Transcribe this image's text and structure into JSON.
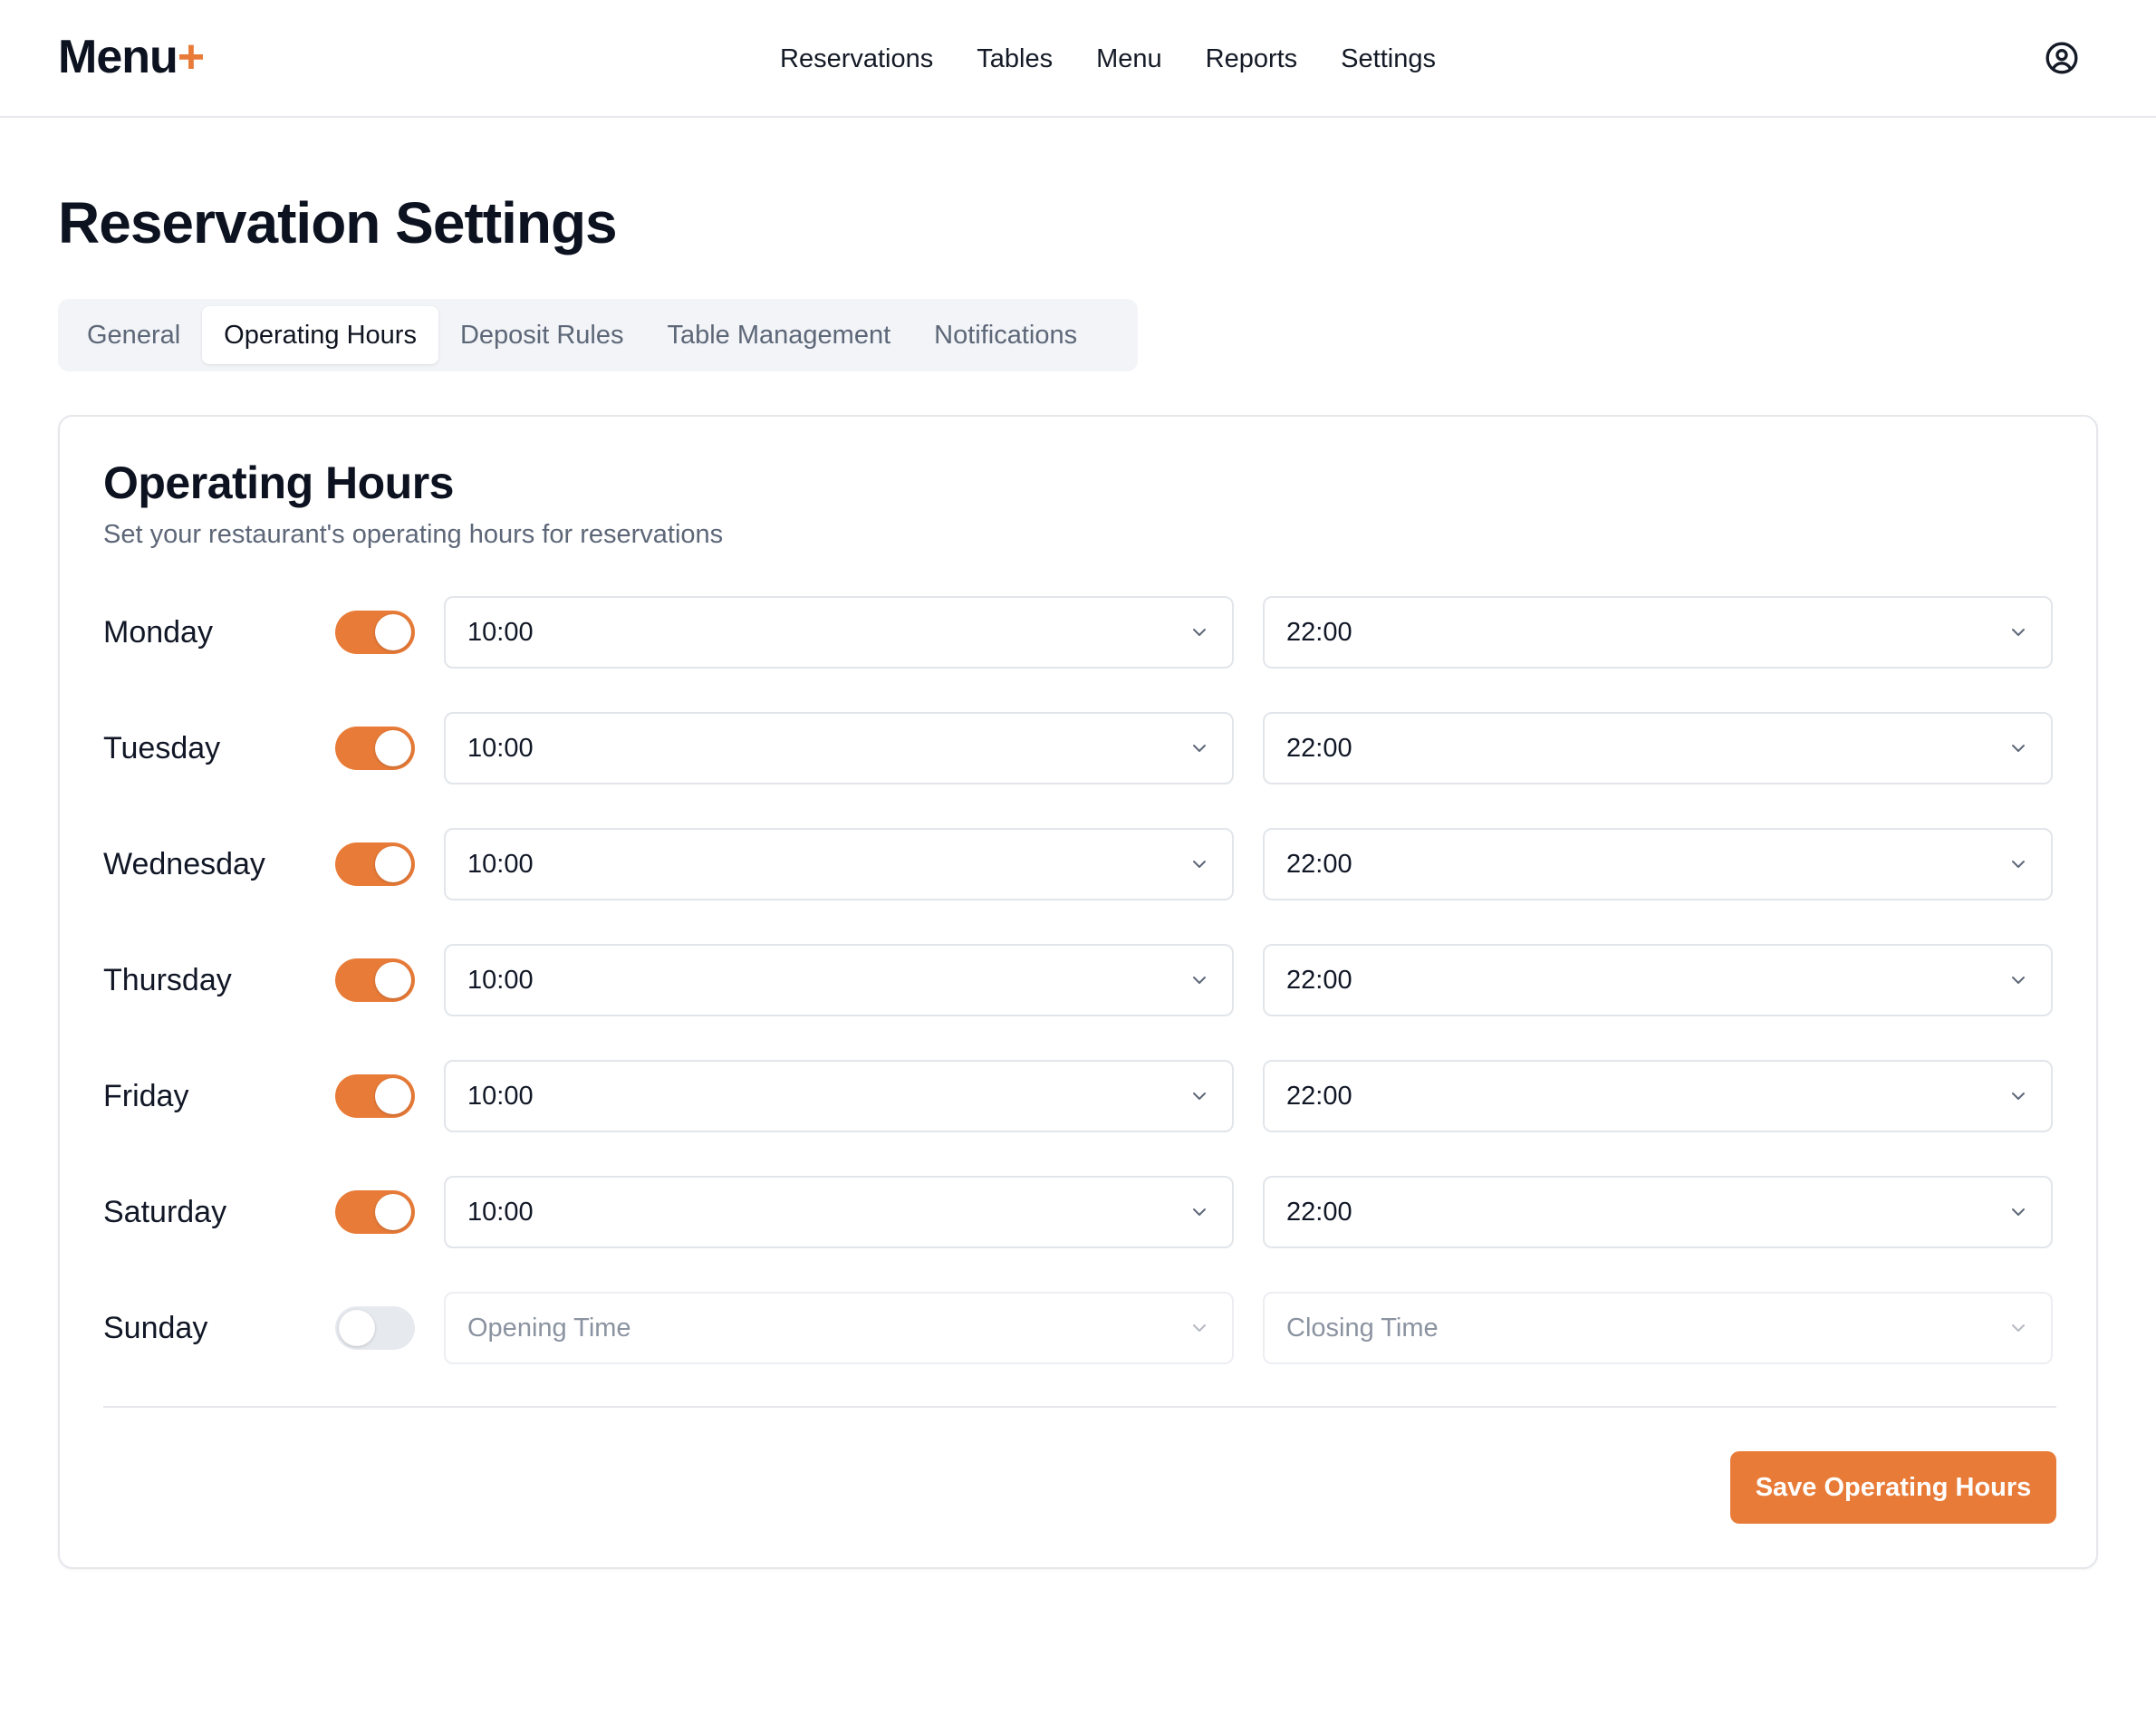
{
  "app": {
    "logo_text": "Menu",
    "logo_accent": "+",
    "accent_color": "#e87b38"
  },
  "nav": {
    "items": [
      "Reservations",
      "Tables",
      "Menu",
      "Reports",
      "Settings"
    ],
    "user_icon": "user-circle-icon"
  },
  "page": {
    "title": "Reservation Settings"
  },
  "tabs": {
    "items": [
      "General",
      "Operating Hours",
      "Deposit Rules",
      "Table Management",
      "Notifications"
    ],
    "active": "Operating Hours"
  },
  "card": {
    "title": "Operating Hours",
    "subtitle": "Set your restaurant's operating hours for reservations",
    "days": [
      {
        "day": "Monday",
        "enabled": true,
        "open": "10:00",
        "close": "22:00"
      },
      {
        "day": "Tuesday",
        "enabled": true,
        "open": "10:00",
        "close": "22:00"
      },
      {
        "day": "Wednesday",
        "enabled": true,
        "open": "10:00",
        "close": "22:00"
      },
      {
        "day": "Thursday",
        "enabled": true,
        "open": "10:00",
        "close": "22:00"
      },
      {
        "day": "Friday",
        "enabled": true,
        "open": "10:00",
        "close": "22:00"
      },
      {
        "day": "Saturday",
        "enabled": true,
        "open": "10:00",
        "close": "22:00"
      },
      {
        "day": "Sunday",
        "enabled": false,
        "open": "Opening Time",
        "close": "Closing Time"
      }
    ],
    "chevron_icon": "chevron-down-icon",
    "save_label": "Save Operating Hours"
  }
}
